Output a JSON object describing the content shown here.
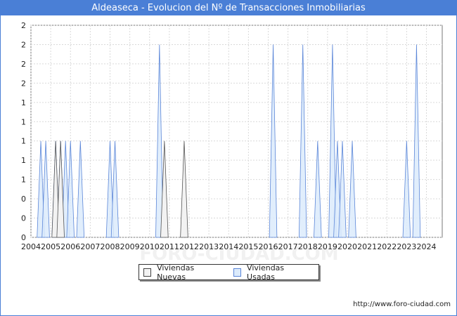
{
  "title": "Aldeaseca - Evolucion del Nº de Transacciones Inmobiliarias",
  "source": "http://www.foro-ciudad.com",
  "watermark": "FORO-CIUDAD.COM",
  "chart_data": {
    "type": "area",
    "title": "Aldeaseca - Evolucion del Nº de Transacciones Inmobiliarias",
    "xlabel": "",
    "ylabel": "",
    "xlim": [
      2004,
      2024.8
    ],
    "ylim": [
      0,
      2.2
    ],
    "grid": true,
    "legend_placement": "bottom",
    "x_ticks": [
      "2004",
      "2005",
      "2006",
      "2007",
      "2008",
      "2009",
      "2010",
      "2011",
      "2012",
      "2013",
      "2014",
      "2015",
      "2016",
      "2017",
      "2018",
      "2019",
      "2020",
      "2021",
      "2022",
      "2023",
      "2024"
    ],
    "y_tick_labels": [
      "0",
      "0",
      "0",
      "1",
      "1",
      "1",
      "1",
      "1",
      "2",
      "2",
      "2",
      "2"
    ],
    "series": [
      {
        "name": "Viviendas Nuevas",
        "color": "#f2f2f2",
        "stroke": "#555555",
        "quarters": [
          {
            "x": 2005.25,
            "y": 1
          },
          {
            "x": 2005.5,
            "y": 1
          },
          {
            "x": 2010.75,
            "y": 1
          },
          {
            "x": 2011.75,
            "y": 1
          }
        ]
      },
      {
        "name": "Viviendas Usadas",
        "color": "#dcebfb",
        "stroke": "#5b86d8",
        "quarters": [
          {
            "x": 2004.5,
            "y": 1
          },
          {
            "x": 2004.75,
            "y": 1
          },
          {
            "x": 2005.25,
            "y": 1
          },
          {
            "x": 2005.5,
            "y": 1
          },
          {
            "x": 2005.75,
            "y": 1
          },
          {
            "x": 2006.0,
            "y": 1
          },
          {
            "x": 2006.5,
            "y": 1
          },
          {
            "x": 2008.0,
            "y": 1
          },
          {
            "x": 2008.25,
            "y": 1
          },
          {
            "x": 2010.5,
            "y": 2
          },
          {
            "x": 2016.25,
            "y": 2
          },
          {
            "x": 2017.75,
            "y": 2
          },
          {
            "x": 2018.5,
            "y": 1
          },
          {
            "x": 2019.25,
            "y": 2
          },
          {
            "x": 2019.5,
            "y": 1
          },
          {
            "x": 2019.75,
            "y": 1
          },
          {
            "x": 2020.25,
            "y": 1
          },
          {
            "x": 2023.0,
            "y": 1
          },
          {
            "x": 2023.5,
            "y": 2
          }
        ]
      }
    ]
  }
}
